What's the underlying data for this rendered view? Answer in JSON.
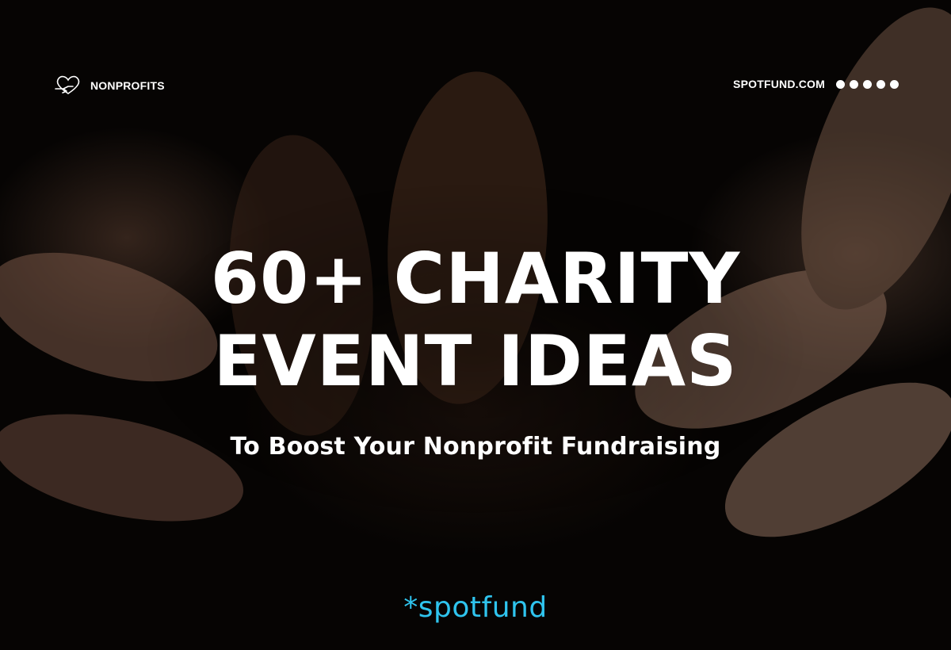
{
  "header": {
    "category": "NONPROFITS",
    "category_icon": "heart-hands-icon",
    "site": "SPOTFUND.COM",
    "pagination_dots": 5
  },
  "headline": {
    "line1": "60+ CHARITY",
    "line2": "EVENT IDEAS",
    "subtitle": "To Boost Your Nonprofit Fundraising"
  },
  "brand": {
    "name": "*spotfund",
    "color": "#2fc4ee"
  },
  "background": {
    "subject": "outstretched open hands",
    "colors": [
      "#060403",
      "#5a3e30",
      "#6e5040"
    ]
  }
}
